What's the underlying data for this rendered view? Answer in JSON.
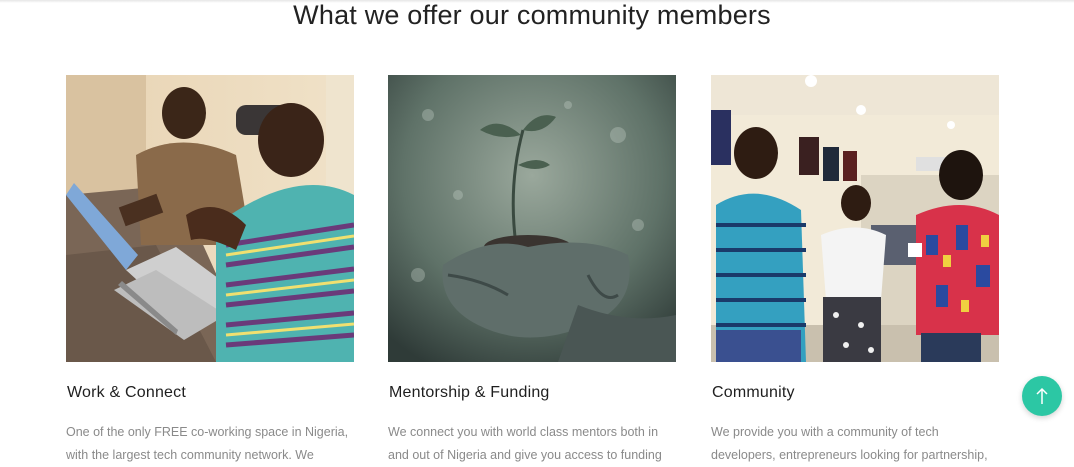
{
  "section": {
    "title": "What we offer our community members"
  },
  "cards": [
    {
      "title": "Work & Connect",
      "description": "One of the only FREE co-working space in Nigeria, with the largest tech community network. We",
      "image": "two-men-working-on-laptops-photo"
    },
    {
      "title": "Mentorship & Funding",
      "description": "We connect you with world class mentors both in and out of Nigeria and give you access to funding",
      "image": "hands-holding-seedling-photo"
    },
    {
      "title": "Community",
      "description": "We provide you with a community of tech developers, entrepreneurs looking for partnership,",
      "image": "people-talking-in-office-photo"
    }
  ],
  "scroll_top": {
    "icon": "arrow-up-icon",
    "color": "#2cc7a4"
  }
}
